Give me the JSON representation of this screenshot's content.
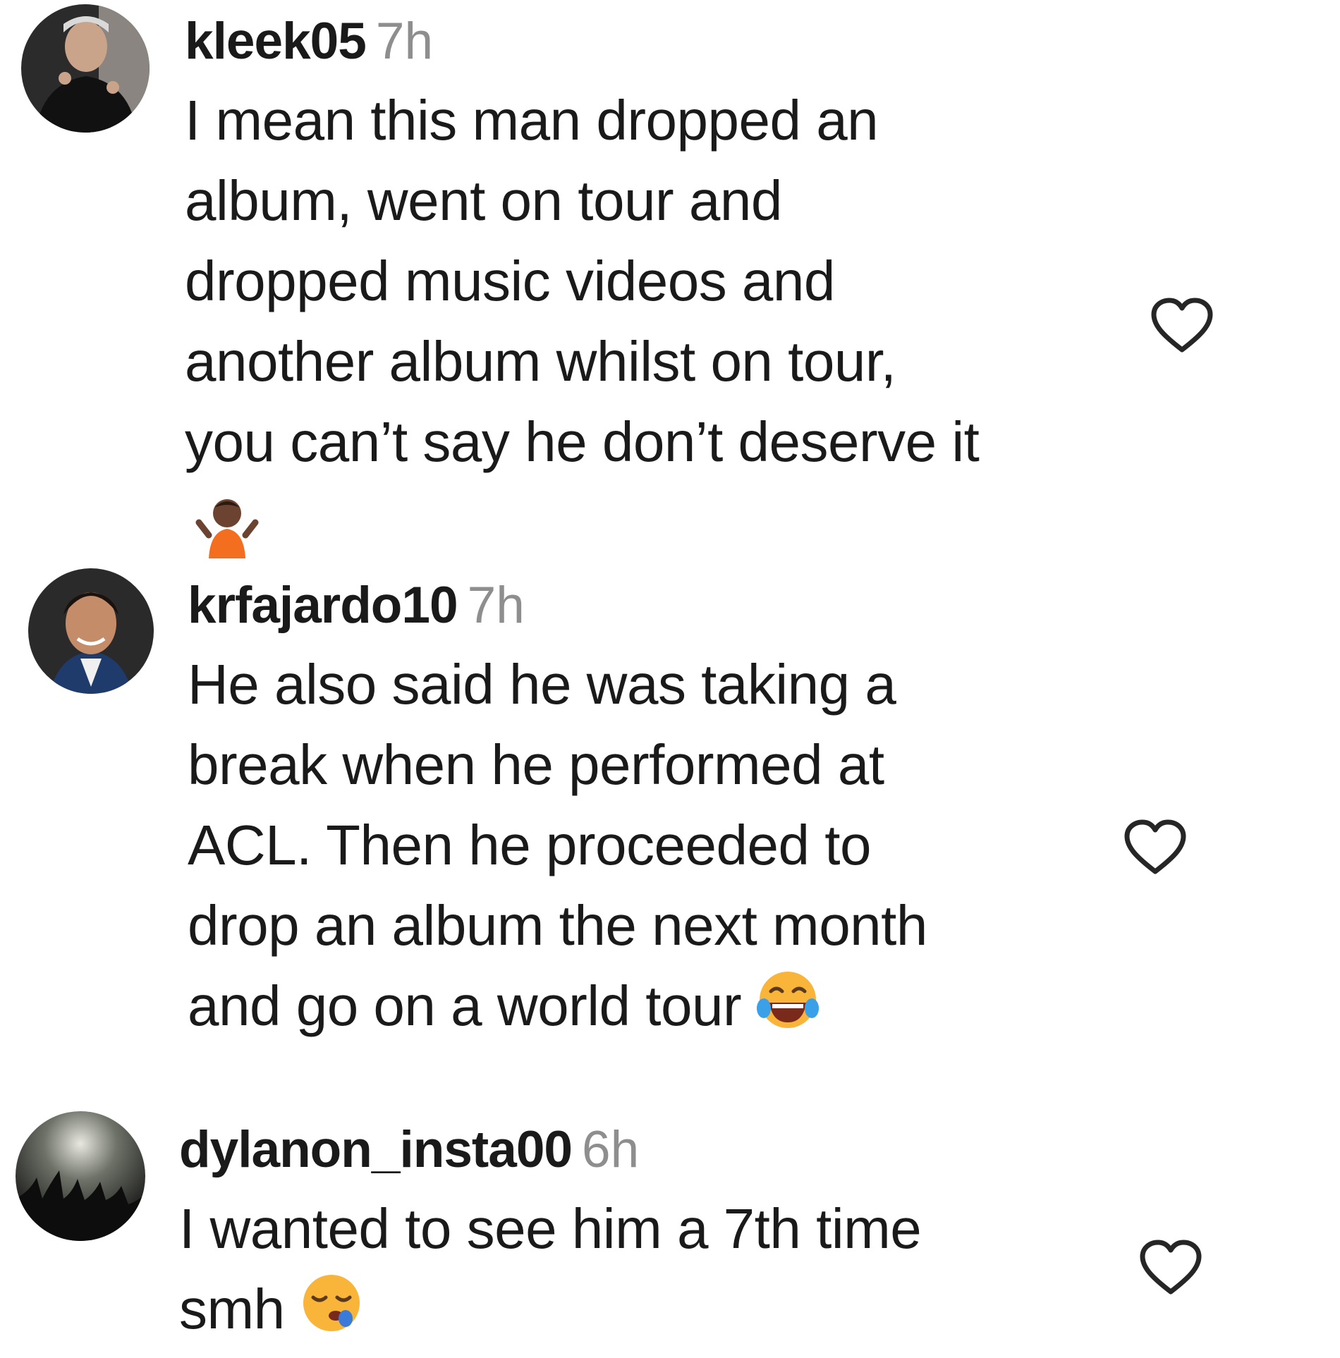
{
  "comments": [
    {
      "username": "kleek05",
      "time": "7h",
      "text": "I mean this man dropped an\nalbum, went on tour and\ndropped music videos and\nanother album whilst on tour,\nyou can’t say he don’t deserve it",
      "emoji": "person-shrugging-emoji",
      "avatar": "user-avatar-kleek05",
      "like_icon": "heart-outline-icon"
    },
    {
      "username": "krfajardo10",
      "time": "7h",
      "text": "He also said he was taking a\nbreak when he performed at\nACL. Then he proceeded to\ndrop an album the next month\nand go on a world tour",
      "emoji": "face-with-tears-of-joy-emoji",
      "avatar": "user-avatar-krfajardo10",
      "like_icon": "heart-outline-icon"
    },
    {
      "username": "dylanon_insta00",
      "time": "6h",
      "text": "I wanted to see him a 7th time\nsmh",
      "emoji": "sleepy-face-emoji",
      "avatar": "user-avatar-dylanon_insta00",
      "like_icon": "heart-outline-icon"
    }
  ],
  "colors": {
    "text": "#1a1a1a",
    "timestamp": "#8e8e8e",
    "heart_stroke": "#262626",
    "background": "#ffffff"
  }
}
